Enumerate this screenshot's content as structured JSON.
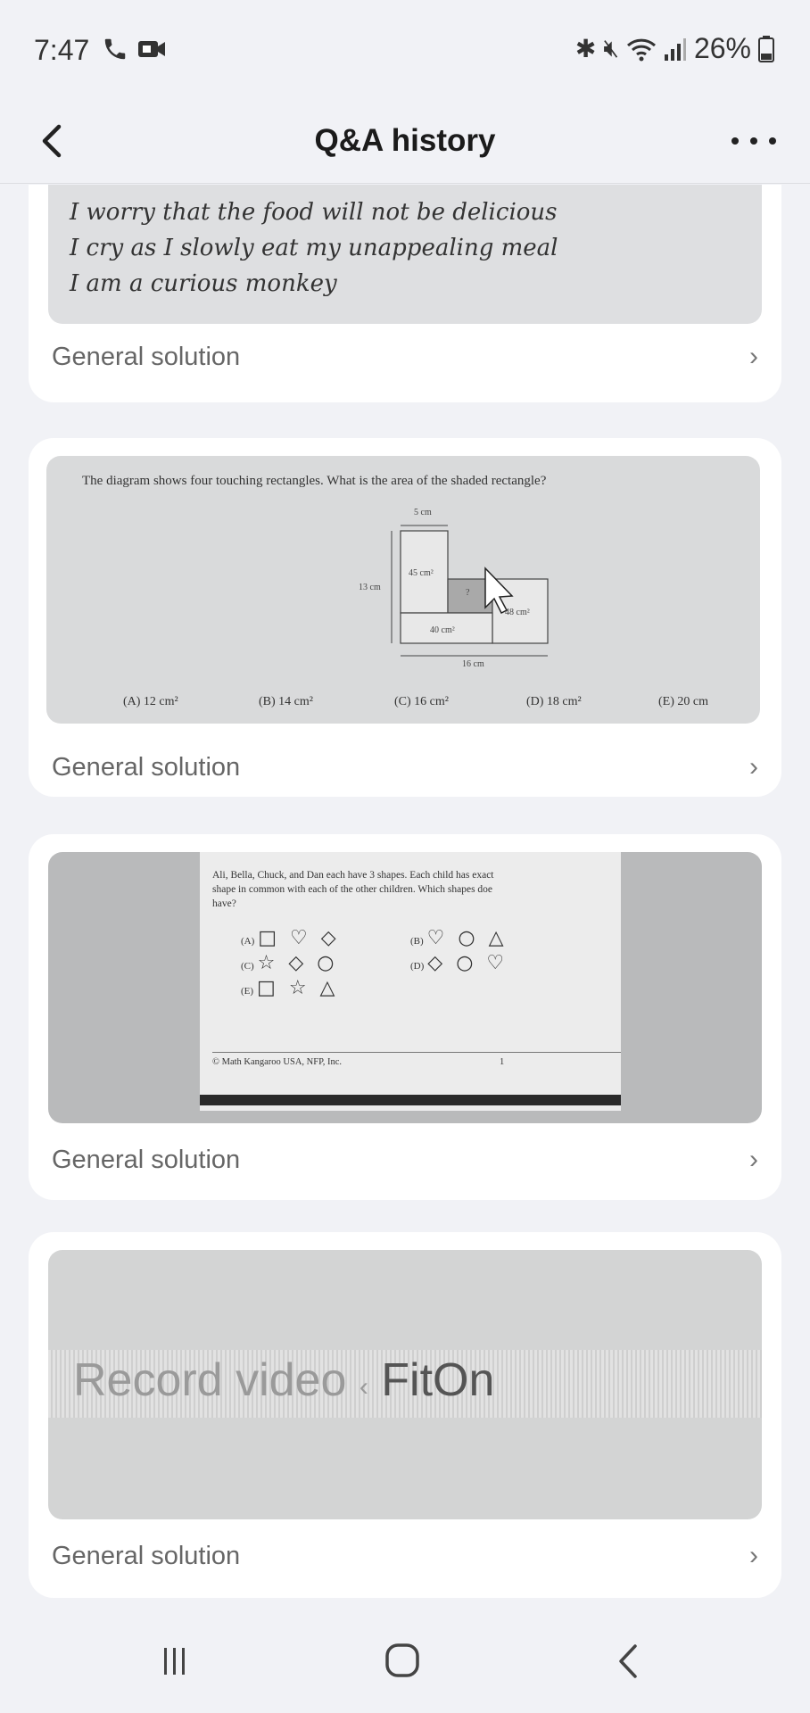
{
  "status": {
    "time": "7:47",
    "battery": "26%",
    "icons": [
      "phone-icon",
      "video-icon",
      "bluetooth-icon",
      "mute-icon",
      "wifi-icon",
      "signal-icon",
      "battery-icon"
    ]
  },
  "header": {
    "title": "Q&A history",
    "back_icon": "chevron-left-icon",
    "more_icon": "more-dots-icon"
  },
  "cards": [
    {
      "handwriting": [
        "I worry that the food will not be delicious",
        "I cry as I slowly eat my unappealing meal",
        "I am a curious monkey"
      ],
      "solution_label": "General solution"
    },
    {
      "question": "The diagram shows four touching rectangles. What is the area of the shaded rectangle?",
      "diagram_labels": {
        "top_width": "5 cm",
        "left_height": "13 cm",
        "rect1": "45 cm²",
        "shaded": "?",
        "rect3": "48 cm²",
        "rect4": "40 cm²",
        "bottom_width": "16 cm"
      },
      "options": [
        "(A) 12 cm²",
        "(B) 14 cm²",
        "(C) 16 cm²",
        "(D) 18 cm²",
        "(E) 20 cm"
      ],
      "solution_label": "General solution"
    },
    {
      "question_lines": [
        "Ali, Bella, Chuck, and Dan each have 3 shapes. Each child has exact",
        "shape in common with each of the other children. Which shapes doe",
        "have?"
      ],
      "options": [
        {
          "letter": "(A)",
          "shapes": "□ ♡ ◇"
        },
        {
          "letter": "(B)",
          "shapes": "♡ ○ △"
        },
        {
          "letter": "(C)",
          "shapes": "☆ ◇ ○"
        },
        {
          "letter": "(D)",
          "shapes": "◇ ○ ♡"
        },
        {
          "letter": "(E)",
          "shapes": "□ ☆ △"
        }
      ],
      "footer": "© Math Kangaroo USA, NFP, Inc.",
      "page_number": "1",
      "solution_label": "General solution"
    },
    {
      "text_left": "Record video",
      "text_sep": "‹",
      "text_right": "FitOn",
      "solution_label": "General solution"
    }
  ],
  "nav": {
    "recents_icon": "recent-apps-icon",
    "home_icon": "home-icon",
    "back_icon": "back-icon"
  },
  "colors": {
    "background": "#f1f2f6",
    "card": "#ffffff",
    "muted_text": "#666666"
  }
}
